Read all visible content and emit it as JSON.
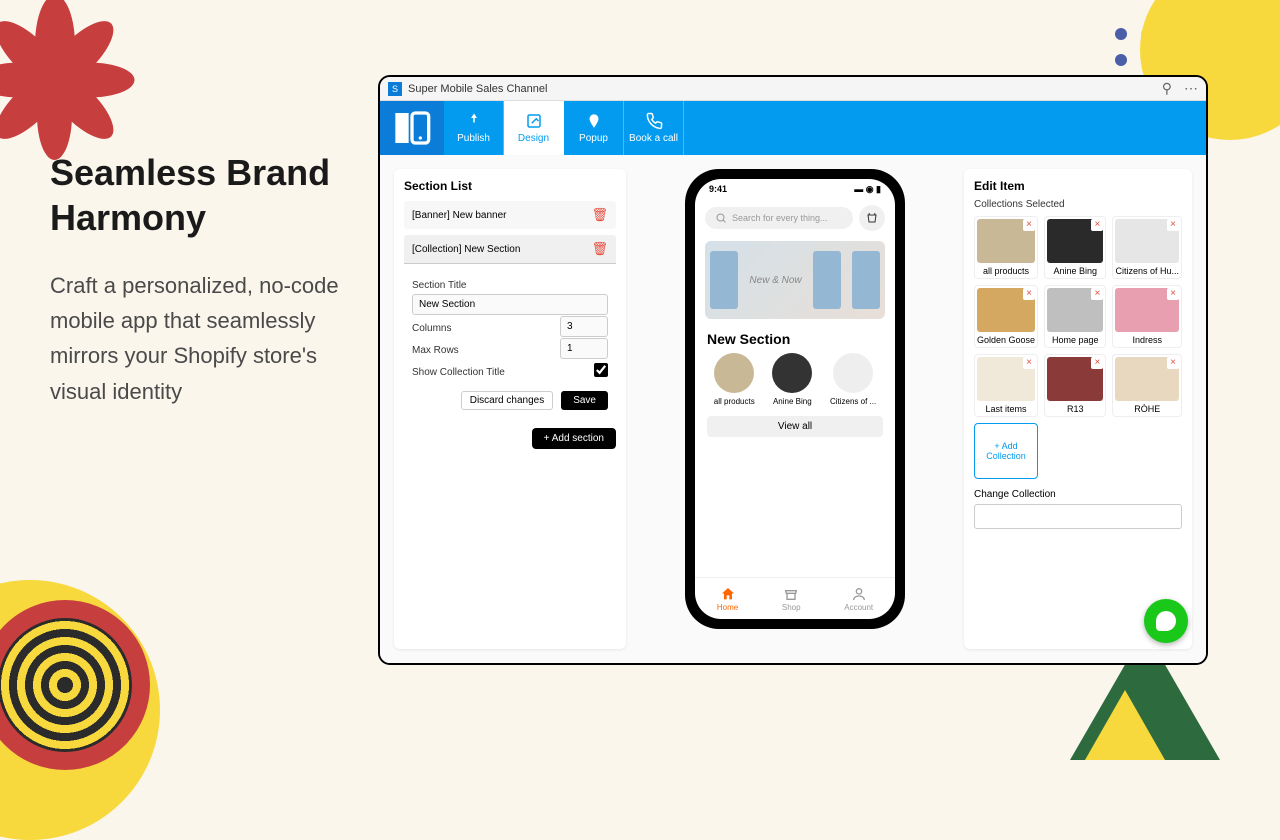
{
  "hero": {
    "title": "Seamless Brand Harmony",
    "body": "Craft a personalized, no-code mobile app that seamlessly mirrors your Shopify store's visual identity"
  },
  "window": {
    "title": "Super Mobile Sales Channel"
  },
  "toolbar": {
    "logo": "SB",
    "items": [
      {
        "label": "Publish",
        "active": false
      },
      {
        "label": "Design",
        "active": true
      },
      {
        "label": "Popup",
        "active": false
      },
      {
        "label": "Book a call",
        "active": false
      }
    ]
  },
  "sectionList": {
    "title": "Section List",
    "items": [
      {
        "label": "[Banner] New banner"
      },
      {
        "label": "[Collection] New Section"
      }
    ],
    "form": {
      "titleLabel": "Section Title",
      "titleValue": "New Section",
      "columnsLabel": "Columns",
      "columnsValue": "3",
      "maxRowsLabel": "Max Rows",
      "maxRowsValue": "1",
      "showTitleLabel": "Show Collection Title",
      "showTitleChecked": true,
      "discard": "Discard changes",
      "save": "Save"
    },
    "addSection": "+  Add section"
  },
  "phone": {
    "time": "9:41",
    "searchPlaceholder": "Search for every thing...",
    "sectionTitle": "New Section",
    "circles": [
      {
        "label": "all products"
      },
      {
        "label": "Anine Bing"
      },
      {
        "label": "Citizens of ..."
      }
    ],
    "viewAll": "View all",
    "nav": [
      {
        "label": "Home",
        "active": true
      },
      {
        "label": "Shop",
        "active": false
      },
      {
        "label": "Account",
        "active": false
      }
    ]
  },
  "editPanel": {
    "title": "Edit Item",
    "subtitle": "Collections Selected",
    "collections": [
      "all products",
      "Anine Bing",
      "Citizens of Hu...",
      "Golden Goose",
      "Home page",
      "Indress",
      "Last items",
      "R13",
      "RÓHE"
    ],
    "addCollection": "+ Add Collection",
    "changeLabel": "Change Collection"
  }
}
